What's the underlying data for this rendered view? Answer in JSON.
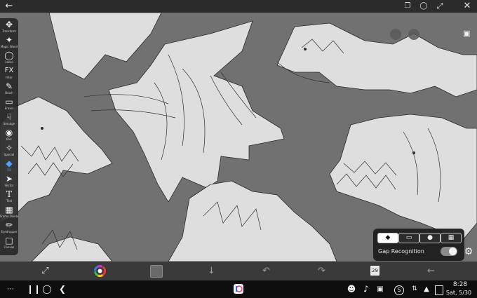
{
  "app": {
    "name": "ibisPaint",
    "launcher_icon": "ibispaint-icon"
  },
  "topbar": {
    "icons": [
      "back-arrow-icon",
      "layers-window-icon",
      "pin-icon",
      "fullscreen-icon",
      "close-icon"
    ]
  },
  "tools": [
    {
      "label": "Transform",
      "icon": "move-icon"
    },
    {
      "label": "Magic Wand",
      "icon": "magic-wand-icon"
    },
    {
      "label": "Lasso",
      "icon": "lasso-icon"
    },
    {
      "label": "Filter",
      "icon": "fx-icon"
    },
    {
      "label": "Brush",
      "icon": "brush-icon"
    },
    {
      "label": "Eraser",
      "icon": "eraser-icon"
    },
    {
      "label": "Smudge",
      "icon": "smudge-icon"
    },
    {
      "label": "Blur",
      "icon": "drop-icon"
    },
    {
      "label": "Special",
      "icon": "special-icon"
    },
    {
      "label": "Fill",
      "icon": "fill-icon",
      "active": true
    },
    {
      "label": "Vector",
      "icon": "vector-icon"
    },
    {
      "label": "Text",
      "icon": "text-icon"
    },
    {
      "label": "Frame Divider",
      "icon": "frame-icon"
    },
    {
      "label": "Eyedropper",
      "icon": "eyedropper-icon"
    },
    {
      "label": "Canvas",
      "icon": "canvas-icon"
    }
  ],
  "fill_panel": {
    "modes": [
      "bucket",
      "eraser",
      "dot",
      "pattern"
    ],
    "gap_recognition_label": "Gap Recognition",
    "gap_recognition_on": false
  },
  "quickbar": {
    "layer_count": "29",
    "icons": [
      "fill-mode-icon",
      "color-wheel-icon",
      "color-swatch-icon",
      "down-arrow-icon",
      "undo-icon",
      "redo-icon",
      "layers-icon",
      "back-icon"
    ]
  },
  "statusbar": {
    "time": "8:28",
    "date": "Sat, 5/30",
    "icons": [
      "apps-icon",
      "recents-icon",
      "home-icon",
      "back-nav-icon",
      "accessibility-icon",
      "mute-icon",
      "screenshot-icon",
      "s-icon",
      "wifi-icon",
      "battery-icon"
    ]
  }
}
